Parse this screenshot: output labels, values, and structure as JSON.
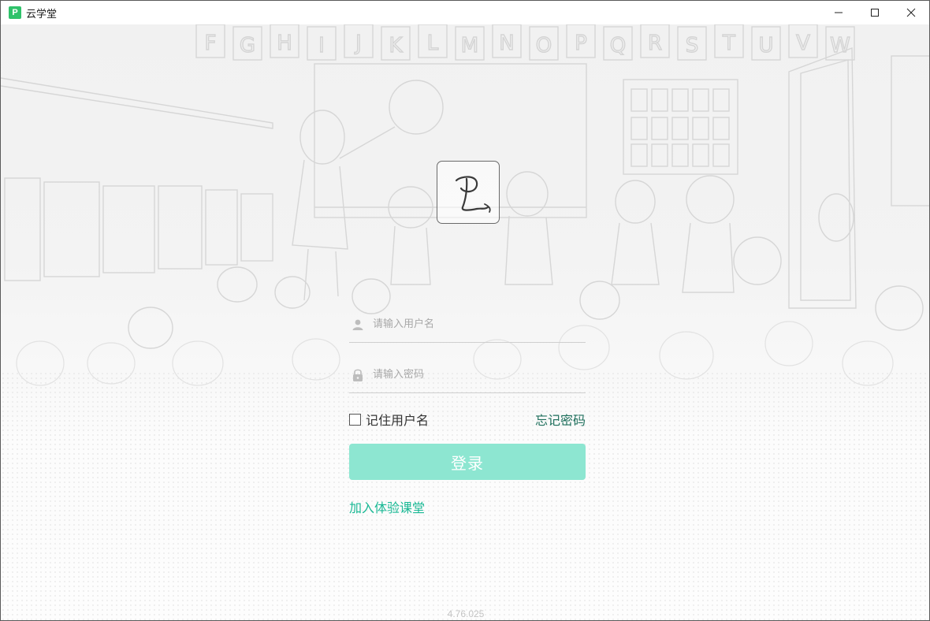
{
  "window": {
    "app_icon_letter": "P",
    "title": "云学堂",
    "controls": {
      "minimize": "minimize-icon",
      "maximize": "maximize-icon",
      "close": "close-icon"
    }
  },
  "background": {
    "alphabet_banner": [
      "F",
      "G",
      "H",
      "I",
      "J",
      "K",
      "L",
      "M",
      "N",
      "O",
      "P",
      "Q",
      "R",
      "S",
      "T",
      "U",
      "V",
      "W"
    ]
  },
  "login": {
    "logo_icon": "p-signature-logo",
    "username": {
      "placeholder": "请输入用户名",
      "value": "",
      "icon": "user-icon"
    },
    "password": {
      "placeholder": "请输入密码",
      "value": "",
      "icon": "lock-icon"
    },
    "remember_label": "记住用户名",
    "remember_checked": false,
    "forgot_label": "忘记密码",
    "submit_label": "登录",
    "trial_label": "加入体验课堂"
  },
  "footer": {
    "version": "4.76.025"
  },
  "colors": {
    "accent": "#19b894",
    "button": "#8de6d1",
    "forgot_link": "#1e6f5c",
    "app_icon": "#2fc26a"
  }
}
